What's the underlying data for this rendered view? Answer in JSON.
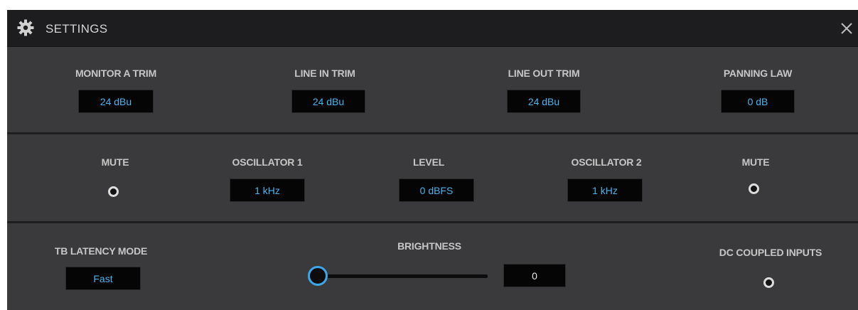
{
  "window": {
    "title": "SETTINGS"
  },
  "row1": {
    "monitor_a_trim": {
      "label": "MONITOR A TRIM",
      "value": "24 dBu"
    },
    "line_in_trim": {
      "label": "LINE IN TRIM",
      "value": "24 dBu"
    },
    "line_out_trim": {
      "label": "LINE OUT TRIM",
      "value": "24 dBu"
    },
    "panning_law": {
      "label": "PANNING LAW",
      "value": "0 dB"
    }
  },
  "row2": {
    "mute_1": {
      "label": "MUTE"
    },
    "oscillator_1": {
      "label": "OSCILLATOR 1",
      "value": "1 kHz"
    },
    "level": {
      "label": "LEVEL",
      "value": "0 dBFS"
    },
    "oscillator_2": {
      "label": "OSCILLATOR 2",
      "value": "1 kHz"
    },
    "mute_2": {
      "label": "MUTE"
    }
  },
  "row3": {
    "tb_latency_mode": {
      "label": "TB LATENCY MODE",
      "value": "Fast"
    },
    "brightness": {
      "label": "BRIGHTNESS",
      "value": "0",
      "level": 0
    },
    "dc_coupled_inputs": {
      "label": "DC COUPLED INPUTS"
    }
  },
  "icons": {
    "title": "gear-icon",
    "close": "close-icon"
  },
  "colors": {
    "background": "#3a3a3c",
    "titlebar": "#1d1d1f",
    "accent_value": "#4ab4ee",
    "slider_accent": "#3aa8e8",
    "label": "#c6c6c6"
  }
}
